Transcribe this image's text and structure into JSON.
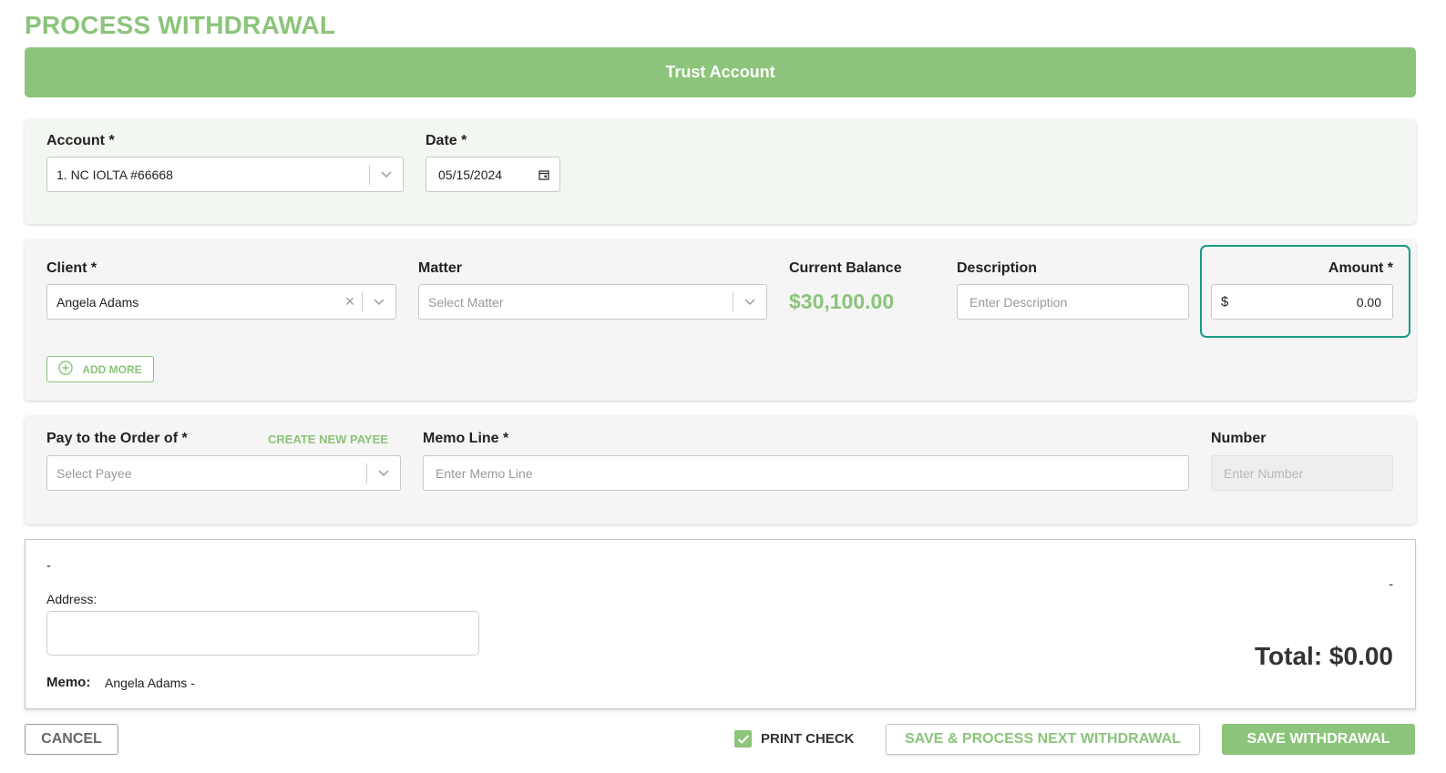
{
  "page": {
    "title": "PROCESS WITHDRAWAL"
  },
  "banner": {
    "label": "Trust Account"
  },
  "account_section": {
    "account_label": "Account *",
    "account_value": "1. NC IOLTA #66668",
    "date_label": "Date *",
    "date_value": "05/15/2024"
  },
  "client_section": {
    "client_label": "Client *",
    "client_value": "Angela Adams",
    "matter_label": "Matter",
    "matter_placeholder": "Select Matter",
    "balance_label": "Current Balance",
    "balance_value": "$30,100.00",
    "description_label": "Description",
    "description_placeholder": "Enter Description",
    "amount_label": "Amount *",
    "amount_currency": "$",
    "amount_value": "0.00",
    "add_more_label": "ADD MORE"
  },
  "payee_section": {
    "payee_label": "Pay to the Order of *",
    "create_payee_label": "CREATE NEW PAYEE",
    "payee_placeholder": "Select Payee",
    "memo_label": "Memo Line *",
    "memo_placeholder": "Enter Memo Line",
    "number_label": "Number",
    "number_placeholder": "Enter Number"
  },
  "check_preview": {
    "payee_dash": "-",
    "right_dash": "-",
    "address_label": "Address:",
    "total": "Total: $0.00",
    "memo_label": "Memo:",
    "memo_value": "Angela Adams -"
  },
  "footer": {
    "cancel_label": "CANCEL",
    "print_check_label": "PRINT CHECK",
    "print_check_checked": true,
    "save_next_label": "SAVE & PROCESS NEXT WITHDRAWAL",
    "save_label": "SAVE WITHDRAWAL"
  },
  "colors": {
    "accent": "#8bc47a",
    "focus": "#1a9a85"
  }
}
